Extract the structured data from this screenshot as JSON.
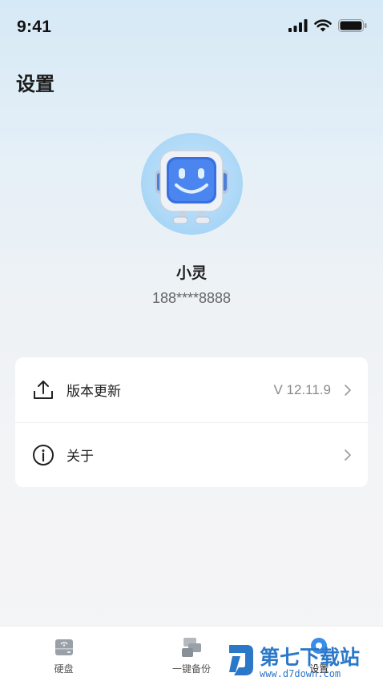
{
  "status": {
    "time": "9:41"
  },
  "header": {
    "title": "设置"
  },
  "profile": {
    "name": "小灵",
    "phone": "188****8888"
  },
  "settings": {
    "items": [
      {
        "label": "版本更新",
        "value": "V 12.11.9",
        "icon": "upload-icon"
      },
      {
        "label": "关于",
        "value": "",
        "icon": "info-icon"
      }
    ]
  },
  "tabbar": {
    "tabs": [
      {
        "label": "硬盘",
        "icon": "disk-icon"
      },
      {
        "label": "一键备份",
        "icon": "backup-icon"
      },
      {
        "label": "设置",
        "icon": "settings-icon",
        "active": true
      }
    ]
  },
  "watermark": {
    "brand": "第七下载站",
    "url": "www.d7down.com"
  },
  "colors": {
    "accent": "#3a8de8",
    "watermark": "#2b78c9"
  }
}
